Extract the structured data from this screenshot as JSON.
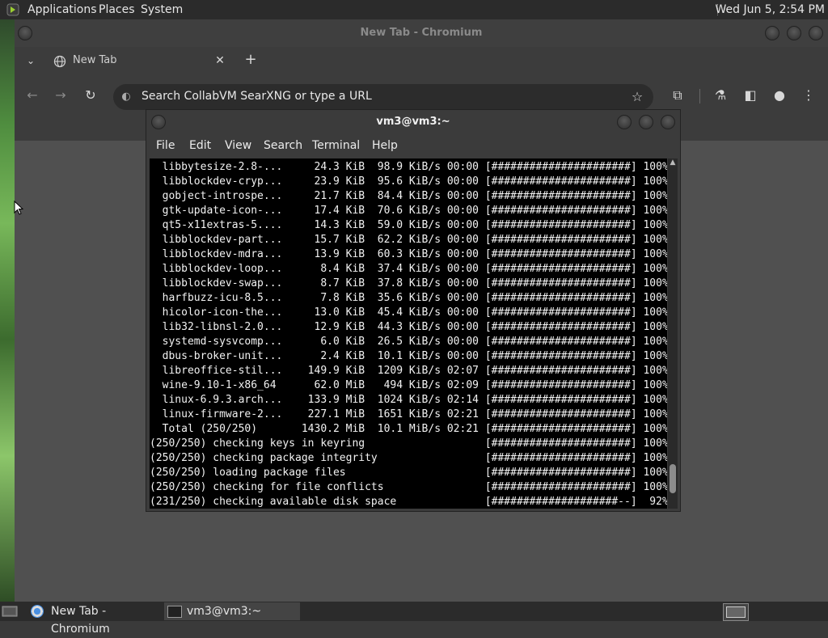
{
  "top_panel": {
    "menus": [
      "Applications",
      "Places",
      "System"
    ],
    "clock": "Wed Jun  5,  2:54 PM"
  },
  "browser": {
    "window_title": "New Tab - Chromium",
    "tab_label": "New Tab",
    "omnibox_placeholder": "Search CollabVM SearXNG or type a URL"
  },
  "terminal": {
    "title": "vm3@vm3:~",
    "menu": [
      "File",
      "Edit",
      "View",
      "Search",
      "Terminal",
      "Help"
    ],
    "lines": [
      "  libbytesize-2.8-...     24.3 KiB  98.9 KiB/s 00:00 [######################] 100%",
      "  libblockdev-cryp...     23.9 KiB  95.6 KiB/s 00:00 [######################] 100%",
      "  gobject-introspe...     21.7 KiB  84.4 KiB/s 00:00 [######################] 100%",
      "  gtk-update-icon-...     17.4 KiB  70.6 KiB/s 00:00 [######################] 100%",
      "  qt5-x11extras-5....     14.3 KiB  59.0 KiB/s 00:00 [######################] 100%",
      "  libblockdev-part...     15.7 KiB  62.2 KiB/s 00:00 [######################] 100%",
      "  libblockdev-mdra...     13.9 KiB  60.3 KiB/s 00:00 [######################] 100%",
      "  libblockdev-loop...      8.4 KiB  37.4 KiB/s 00:00 [######################] 100%",
      "  libblockdev-swap...      8.7 KiB  37.8 KiB/s 00:00 [######################] 100%",
      "  harfbuzz-icu-8.5...      7.8 KiB  35.6 KiB/s 00:00 [######################] 100%",
      "  hicolor-icon-the...     13.0 KiB  45.4 KiB/s 00:00 [######################] 100%",
      "  lib32-libnsl-2.0...     12.9 KiB  44.3 KiB/s 00:00 [######################] 100%",
      "  systemd-sysvcomp...      6.0 KiB  26.5 KiB/s 00:00 [######################] 100%",
      "  dbus-broker-unit...      2.4 KiB  10.1 KiB/s 00:00 [######################] 100%",
      "  libreoffice-stil...    149.9 KiB  1209 KiB/s 02:07 [######################] 100%",
      "  wine-9.10-1-x86_64      62.0 MiB   494 KiB/s 02:09 [######################] 100%",
      "  linux-6.9.3.arch...    133.9 MiB  1024 KiB/s 02:14 [######################] 100%",
      "  linux-firmware-2...    227.1 MiB  1651 KiB/s 02:21 [######################] 100%",
      "  Total (250/250)       1430.2 MiB  10.1 MiB/s 02:21 [######################] 100%",
      "(250/250) checking keys in keyring                   [######################] 100%",
      "(250/250) checking package integrity                 [######################] 100%",
      "(250/250) loading package files                      [######################] 100%",
      "(250/250) checking for file conflicts                [######################] 100%",
      "(231/250) checking available disk space              [####################--]  92%"
    ]
  },
  "taskbar": {
    "tasks": [
      "New Tab - Chromium",
      "vm3@vm3:~"
    ]
  }
}
